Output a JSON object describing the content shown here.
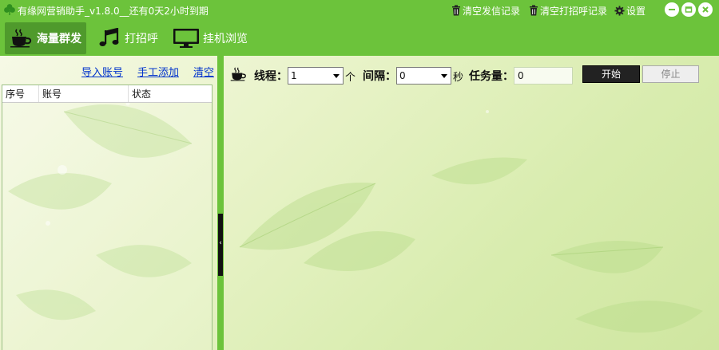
{
  "window": {
    "title": "有缘网营销助手_v1.8.0__还有0天2小时到期",
    "actions": {
      "clear_sent": "清空发信记录",
      "clear_greet": "清空打招呼记录",
      "settings": "设置"
    }
  },
  "toolbar": {
    "tabs": [
      {
        "label": "海量群发",
        "icon": "coffee-icon",
        "active": true
      },
      {
        "label": "打招呼",
        "icon": "music-note-icon",
        "active": false
      },
      {
        "label": "挂机浏览",
        "icon": "monitor-icon",
        "active": false
      }
    ]
  },
  "left": {
    "links": {
      "import": "导入账号",
      "manual_add": "手工添加",
      "clear": "清空"
    },
    "table": {
      "columns": [
        "序号",
        "账号",
        "状态"
      ],
      "rows": []
    }
  },
  "right": {
    "threads_label": "线程：",
    "threads_value": "1",
    "threads_unit": "个",
    "interval_label": "间隔：",
    "interval_value": "0",
    "interval_unit": "秒",
    "tasks_label": "任务量：",
    "tasks_value": "0",
    "start_label": "开始",
    "stop_label": "停止"
  },
  "colors": {
    "brand_green": "#6cc33b",
    "active_tab": "#4f9a2c",
    "link_blue": "#0033cc"
  }
}
